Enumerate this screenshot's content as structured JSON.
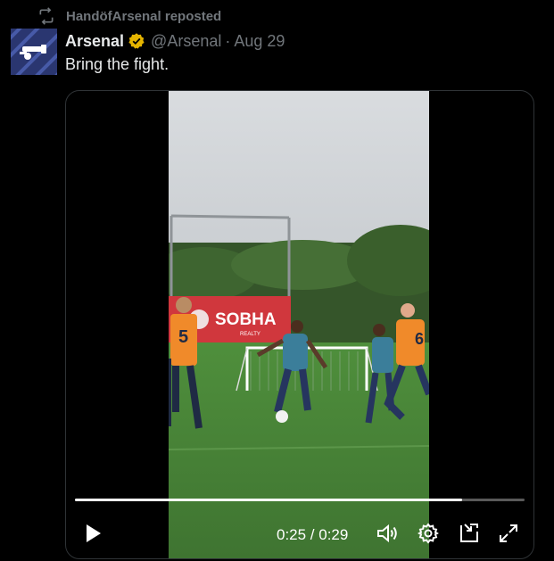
{
  "repost": {
    "text": "HandöfArsenal reposted",
    "icon": "repost-icon"
  },
  "post": {
    "author_name": "Arsenal",
    "verified": true,
    "handle": "@Arsenal",
    "separator": "·",
    "date": "Aug 29",
    "text": "Bring the fight."
  },
  "video": {
    "current_time": "0:25",
    "duration": "0:29",
    "time_display": "0:25 / 0:29",
    "progress_fraction": 0.862,
    "sponsor_board": {
      "name": "SOBHA",
      "sub": "REALTY"
    },
    "bib_numbers": [
      "5",
      "6"
    ]
  },
  "controls": {
    "play": "play-icon",
    "volume": "volume-icon",
    "settings": "settings-icon",
    "minimize": "minimize-icon",
    "fullscreen": "fullscreen-icon"
  },
  "colors": {
    "background": "#000000",
    "muted_text": "#71767b",
    "primary_text": "#e7e9ea",
    "verified_badge": "#e5b400",
    "bib": "#f08a2a",
    "pitch": "#4e8a3a"
  }
}
